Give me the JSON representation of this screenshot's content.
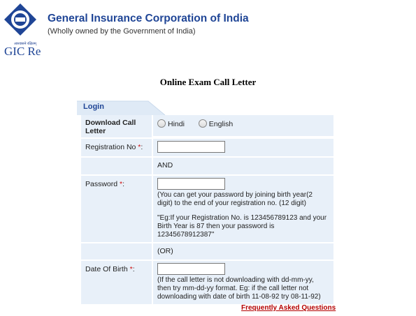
{
  "header": {
    "logo_hindi": "आश्वासने रक्षितम्",
    "logo_text": "GIC Re",
    "org_name": "General Insurance Corporation of India",
    "org_subtitle": "(Wholly owned by the Government of India)"
  },
  "page_title": "Online Exam Call Letter",
  "login_tab": "Login",
  "form": {
    "download_label": "Download Call Letter",
    "lang_options": [
      "Hindi",
      "English"
    ],
    "reg_label": "Registration No",
    "required_mark": "*",
    "colon": ":",
    "and_text": "AND",
    "password_label": "Password",
    "password_note1": "(You can get your password by joining birth year(2 digit) to the end of your registration no. (12 digit)",
    "password_note2": "\"Eg:If your Registration No. is 123456789123 and your Birth Year is 87 then your password is 12345678912387\"",
    "or_text": "(OR)",
    "dob_label": "Date Of Birth",
    "dob_note": "(If the call letter is not downloading with dd-mm-yy, then try mm-dd-yy format. Eg: if the call letter not downloading with date of birth 11-08-92 try 08-11-92)",
    "reg_value": "",
    "password_value": "",
    "dob_value": ""
  },
  "faq_link": "Frequently Asked Questions",
  "colors": {
    "brand": "#1f4596",
    "row_bg": "#e8f0f9",
    "required": "#d01010",
    "link": "#b40000"
  }
}
